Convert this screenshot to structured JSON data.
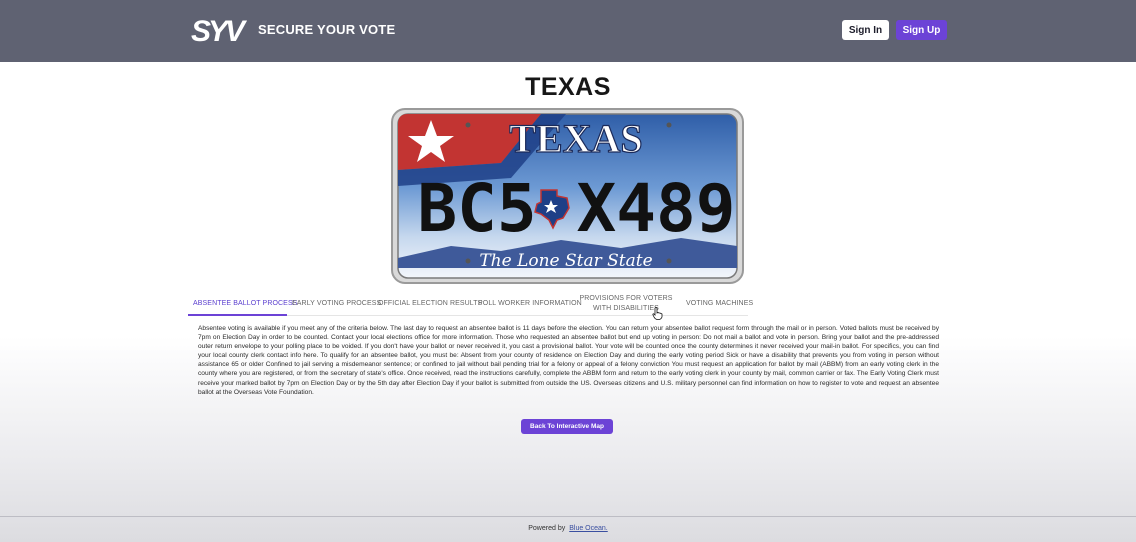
{
  "header": {
    "brand": "SECURE YOUR VOTE",
    "logo_text": "SYV",
    "sign_in": "Sign In",
    "sign_up": "Sign Up",
    "bg_color": "#5f6272",
    "accent_color": "#6c43d6"
  },
  "state": {
    "title": "TEXAS",
    "plate": {
      "header": "TEXAS",
      "number_left": "BC5",
      "number_right": "X489",
      "slogan": "The Lone Star State"
    }
  },
  "tabs": [
    {
      "label": "ABSENTEE BALLOT PROCESS",
      "active": true
    },
    {
      "label": "EARLY VOTING PROCESS",
      "active": false
    },
    {
      "label": "OFFICIAL ELECTION RESULTS",
      "active": false
    },
    {
      "label": "POLL WORKER INFORMATION",
      "active": false
    },
    {
      "label": "PROVISIONS FOR VOTERS WITH DISABILITIES",
      "active": false
    },
    {
      "label": "VOTING MACHINES",
      "active": false
    }
  ],
  "content": {
    "text": "Absentee voting is available if you meet any of the criteria below. The last day to request an absentee ballot is 11 days before the election. You can return your absentee ballot request form through the mail or in person. Voted ballots must be received by 7pm on Election Day in order to be counted. Contact your local elections office for more information. Those who requested an absentee ballot but end up voting in person: Do not mail a ballot and vote in person. Bring your ballot and the pre-addressed outer return envelope to your polling place to be voided. If you don't have your ballot or never received it, you cast a provisional ballot. Your vote will be counted once the county determines it never received your mail-in ballot. For specifics, you can find your local county clerk contact info here. To qualify for an absentee ballot, you must be: Absent from your county of residence on Election Day and during the early voting period Sick or have a disability that prevents you from voting in person without assistance 65 or older Confined to jail serving a misdemeanor sentence; or confined to jail without bail pending trial for a felony or appeal of a felony conviction You must request an application for ballot by mail (ABBM) from an early voting clerk in the county where you are registered, or from the secretary of state's office. Once received, read the instructions carefully, complete the ABBM form and return to the early voting clerk in your county by mail, common carrier or fax. The Early Voting Clerk must receive your marked ballot by 7pm on Election Day or by the 5th day after Election Day if your ballot is submitted from outside the US. Overseas citizens and U.S. military personnel can find information on how to register to vote and request an absentee ballot at the Overseas Vote Foundation.",
    "back_button": "Back To Interactive Map"
  },
  "footer": {
    "powered_by": "Powered by",
    "company": "Blue Ocean."
  }
}
